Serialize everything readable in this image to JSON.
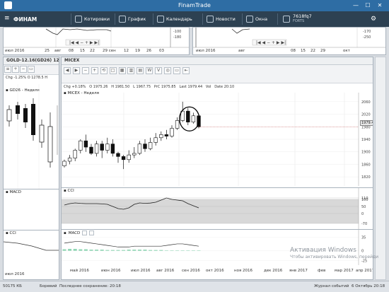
{
  "window": {
    "title": "FinamTrade",
    "minimize": "—",
    "maximize": "☐",
    "close": "✕"
  },
  "toolbar": {
    "brand": "ФИНАМ",
    "items": [
      "Котировки",
      "График",
      "Календарь",
      "Новости",
      "Окна"
    ],
    "account": "7618fq7",
    "account_sub": "FORTS"
  },
  "top_left": {
    "y_labels": [
      "-100",
      "-180"
    ],
    "x_labels": [
      "июл 2016",
      "25",
      "авг",
      "08",
      "15",
      "22",
      "29 сен",
      "12",
      "19",
      "26",
      "03"
    ]
  },
  "top_right": {
    "y_labels": [
      "-170",
      "-250"
    ],
    "x_labels": [
      "июл 2016",
      "авг",
      "08",
      "15",
      "22",
      "29",
      "окт"
    ]
  },
  "gold_panel": {
    "title": "GOLD-12.16(GD26) 12S",
    "info": "Chg -1.25%  O 1278.5  H",
    "chart_label": "GD26 - Неделя",
    "sub_macd": "MACD",
    "sub_cci": "CCI",
    "x_labels": [
      "июл 2016"
    ]
  },
  "micex_panel": {
    "title": "MICEX",
    "info_chg": "Chg +0.18%",
    "info_o": "O 1975.26",
    "info_h": "H 1981.50",
    "info_l": "L 1967.75",
    "info_prc": "PrC 1975.85",
    "info_last": "Last 1979.44",
    "info_vol": "Vol",
    "info_date": "Date 20:10",
    "chart_label": "MICEX - Неделя",
    "last_price": "1979.44",
    "sub_cci": "CCI",
    "sub_macd": "MACD",
    "tools": [
      "◀",
      "▶",
      "−",
      "+",
      "⟲",
      "□",
      "▦",
      "▥",
      "▤",
      "W",
      "V",
      "◎",
      "▭",
      "⇤"
    ],
    "x_labels": [
      "май 2016",
      "июн 2016",
      "июл 2016",
      "авг 2016",
      "сен 2016",
      "окт 2016",
      "ноя 2016",
      "дек 2016",
      "янв 2017",
      "фев",
      "мар 2017",
      "апр 2017",
      "май 2017"
    ]
  },
  "chart_data": [
    {
      "type": "candlestick",
      "title": "MICEX - Неделя",
      "ylim": [
        1800,
        2080
      ],
      "y_ticks": [
        1820,
        1860,
        1900,
        1940,
        1980,
        2020,
        2060
      ],
      "last": 1979.44,
      "candles": [
        [
          1855,
          1870,
          1850,
          1875
        ],
        [
          1870,
          1880,
          1860,
          1890
        ],
        [
          1880,
          1905,
          1870,
          1910
        ],
        [
          1905,
          1935,
          1895,
          1940
        ],
        [
          1935,
          1915,
          1900,
          1955
        ],
        [
          1915,
          1895,
          1890,
          1925
        ],
        [
          1895,
          1925,
          1885,
          1935
        ],
        [
          1925,
          1905,
          1880,
          1935
        ],
        [
          1905,
          1925,
          1895,
          1945
        ],
        [
          1925,
          1895,
          1885,
          1940
        ],
        [
          1895,
          1885,
          1865,
          1900
        ],
        [
          1885,
          1875,
          1845,
          1890
        ],
        [
          1875,
          1890,
          1865,
          1905
        ],
        [
          1890,
          1895,
          1880,
          1915
        ],
        [
          1895,
          1925,
          1890,
          1935
        ],
        [
          1925,
          1910,
          1900,
          1940
        ],
        [
          1910,
          1930,
          1905,
          1945
        ],
        [
          1930,
          1945,
          1920,
          1960
        ],
        [
          1945,
          1955,
          1935,
          1965
        ],
        [
          1955,
          1950,
          1940,
          1970
        ],
        [
          1950,
          1975,
          1945,
          1985
        ],
        [
          1975,
          2000,
          1970,
          2010
        ],
        [
          2000,
          2030,
          1995,
          2060
        ],
        [
          2030,
          1995,
          1985,
          2040
        ],
        [
          1995,
          2015,
          1990,
          2025
        ],
        [
          2015,
          1980,
          1975,
          2020
        ]
      ]
    },
    {
      "type": "line",
      "title": "CCI",
      "y_ticks": [
        110,
        100,
        50,
        0,
        -70
      ],
      "values": [
        60,
        70,
        75,
        72,
        70,
        70,
        70,
        68,
        65,
        50,
        35,
        30,
        40,
        65,
        75,
        72,
        74,
        80,
        95,
        110,
        100,
        95,
        90,
        70,
        55,
        40
      ]
    },
    {
      "type": "line",
      "title": "MACD",
      "y_ticks": [
        35,
        0,
        -25
      ],
      "macd": [
        20,
        22,
        24,
        24,
        22,
        20,
        18,
        16,
        14,
        12,
        10,
        10,
        10,
        12,
        12,
        12,
        12,
        12,
        12,
        14,
        16,
        18,
        18,
        16,
        14,
        12
      ],
      "histogram": [
        4,
        5,
        5,
        4,
        4,
        3,
        3,
        3,
        2,
        2,
        2,
        2,
        3,
        3,
        3,
        3,
        2,
        2,
        2,
        1,
        1,
        1,
        1,
        1,
        1,
        1
      ]
    }
  ],
  "status": {
    "mem": "50175 КБ",
    "server": "Боревий",
    "saved": "Последнее сохранение: 20:18",
    "journal": "Журнал событий",
    "date": "6 Октябрь 20:18"
  },
  "watermark": {
    "line1": "Активация Windows",
    "line2": "Чтобы активировать Windows, перейдите в раздел «Параметры»."
  }
}
